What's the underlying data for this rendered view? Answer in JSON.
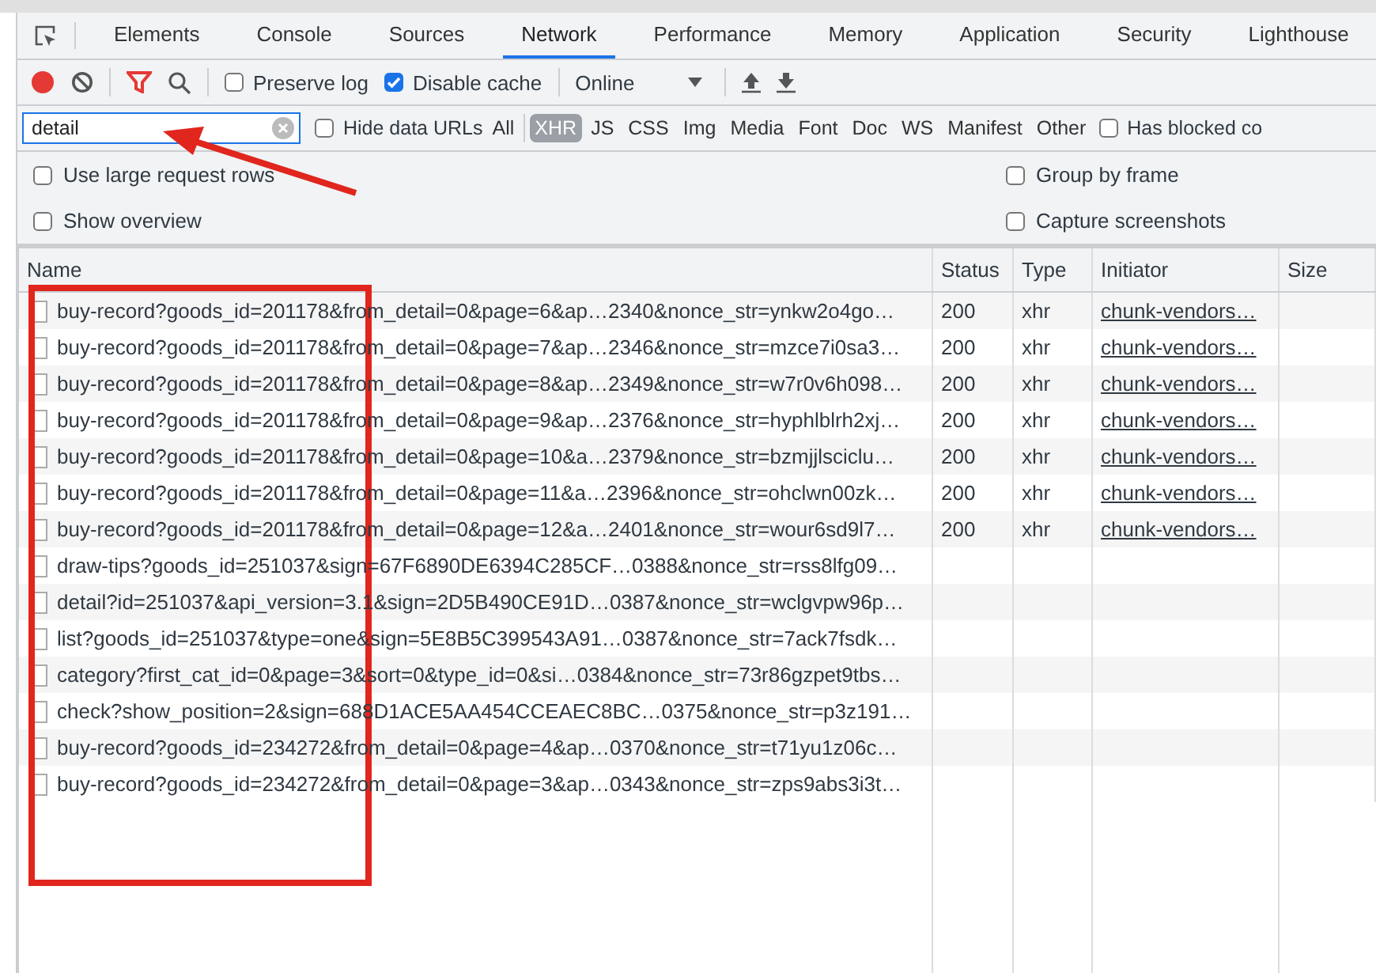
{
  "tabs": [
    {
      "label": "Elements",
      "selected": false
    },
    {
      "label": "Console",
      "selected": false
    },
    {
      "label": "Sources",
      "selected": false
    },
    {
      "label": "Network",
      "selected": true
    },
    {
      "label": "Performance",
      "selected": false
    },
    {
      "label": "Memory",
      "selected": false
    },
    {
      "label": "Application",
      "selected": false
    },
    {
      "label": "Security",
      "selected": false
    },
    {
      "label": "Lighthouse",
      "selected": false
    }
  ],
  "toolbar": {
    "recording": true,
    "preserve_log": {
      "label": "Preserve log",
      "checked": false
    },
    "disable_cache": {
      "label": "Disable cache",
      "checked": true
    },
    "throttling": "Online"
  },
  "filter": {
    "value": "detail",
    "hide_data_urls": {
      "label": "Hide data URLs",
      "checked": false
    },
    "types": [
      {
        "label": "All",
        "selected": false
      },
      {
        "label": "XHR",
        "selected": true
      },
      {
        "label": "JS",
        "selected": false
      },
      {
        "label": "CSS",
        "selected": false
      },
      {
        "label": "Img",
        "selected": false
      },
      {
        "label": "Media",
        "selected": false
      },
      {
        "label": "Font",
        "selected": false
      },
      {
        "label": "Doc",
        "selected": false
      },
      {
        "label": "WS",
        "selected": false
      },
      {
        "label": "Manifest",
        "selected": false
      },
      {
        "label": "Other",
        "selected": false
      }
    ],
    "has_blocked": {
      "label": "Has blocked co",
      "checked": false
    }
  },
  "settings": [
    {
      "label": "Use large request rows",
      "checked": false
    },
    {
      "label": "Group by frame",
      "checked": false
    },
    {
      "label": "Show overview",
      "checked": false
    },
    {
      "label": "Capture screenshots",
      "checked": false
    }
  ],
  "table": {
    "columns": [
      "Name",
      "Status",
      "Type",
      "Initiator",
      "Size"
    ],
    "rows": [
      {
        "name": "buy-record?goods_id=201178&from_detail=0&page=6&ap…2340&nonce_str=ynkw2o4go…",
        "status": "200",
        "type": "xhr",
        "initiator": "chunk-vendors…"
      },
      {
        "name": "buy-record?goods_id=201178&from_detail=0&page=7&ap…2346&nonce_str=mzce7i0sa3…",
        "status": "200",
        "type": "xhr",
        "initiator": "chunk-vendors…"
      },
      {
        "name": "buy-record?goods_id=201178&from_detail=0&page=8&ap…2349&nonce_str=w7r0v6h098…",
        "status": "200",
        "type": "xhr",
        "initiator": "chunk-vendors…"
      },
      {
        "name": "buy-record?goods_id=201178&from_detail=0&page=9&ap…2376&nonce_str=hyphlblrh2xj…",
        "status": "200",
        "type": "xhr",
        "initiator": "chunk-vendors…"
      },
      {
        "name": "buy-record?goods_id=201178&from_detail=0&page=10&a…2379&nonce_str=bzmjjlsciclu…",
        "status": "200",
        "type": "xhr",
        "initiator": "chunk-vendors…"
      },
      {
        "name": "buy-record?goods_id=201178&from_detail=0&page=11&a…2396&nonce_str=ohclwn00zk…",
        "status": "200",
        "type": "xhr",
        "initiator": "chunk-vendors…"
      },
      {
        "name": "buy-record?goods_id=201178&from_detail=0&page=12&a…2401&nonce_str=wour6sd9l7…",
        "status": "200",
        "type": "xhr",
        "initiator": "chunk-vendors…"
      },
      {
        "name": "draw-tips?goods_id=251037&sign=67F6890DE6394C285CF…0388&nonce_str=rss8lfg09…"
      },
      {
        "name": "detail?id=251037&api_version=3.1&sign=2D5B490CE91D…0387&nonce_str=wclgvpw96p…"
      },
      {
        "name": "list?goods_id=251037&type=one&sign=5E8B5C399543A91…0387&nonce_str=7ack7fsdk…"
      },
      {
        "name": "category?first_cat_id=0&page=3&sort=0&type_id=0&si…0384&nonce_str=73r86gzpet9tbs…"
      },
      {
        "name": "check?show_position=2&sign=688D1ACE5AA454CCEAEC8BC…0375&nonce_str=p3z191…"
      },
      {
        "name": "buy-record?goods_id=234272&from_detail=0&page=4&ap…0370&nonce_str=t71yu1z06c…"
      },
      {
        "name": "buy-record?goods_id=234272&from_detail=0&page=3&ap…0343&nonce_str=zps9abs3i3t…"
      }
    ]
  }
}
